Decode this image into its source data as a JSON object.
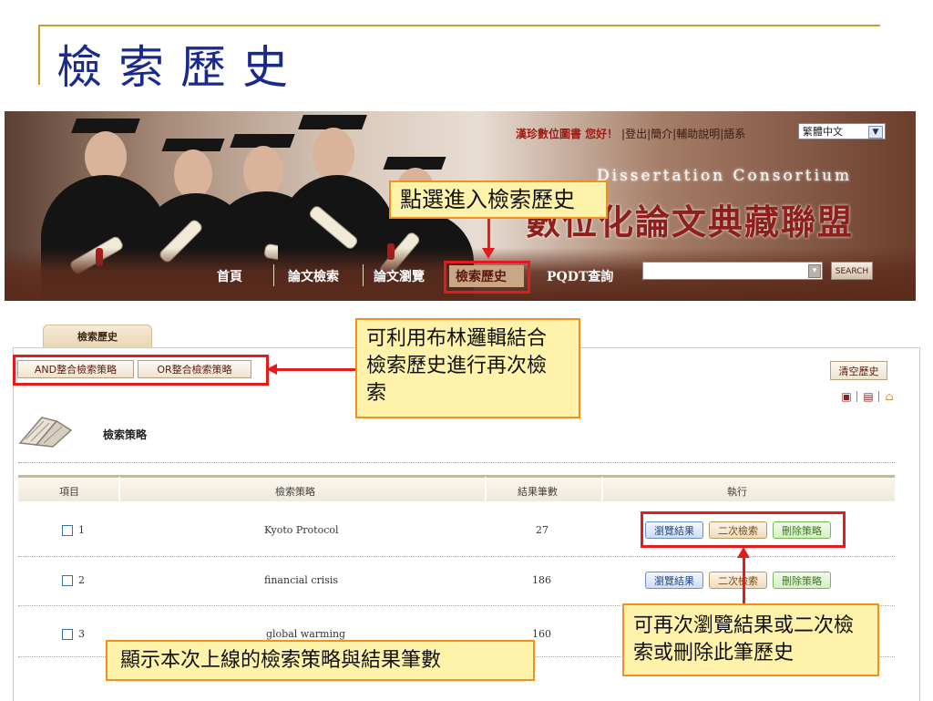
{
  "slide": {
    "title": "檢索歷史"
  },
  "header": {
    "user_greeting": "漢珍數位圖書 您好！",
    "links": [
      "登出",
      "簡介",
      "輔助說明",
      "語系"
    ],
    "language_selected": "繁體中文",
    "site_title_en": "Dissertation Consortium",
    "site_title_zh": "數位化論文典藏聯盟",
    "nav": [
      "首頁",
      "論文檢索",
      "論文瀏覽",
      "檢索歷史",
      "PQDT查詢"
    ],
    "search_button": "SEARCH",
    "search_value": ""
  },
  "panel": {
    "tab": "檢索歷史",
    "and_button": "AND整合檢索策略",
    "or_button": "OR整合檢索策略",
    "clear_button": "清空歷史",
    "section_label": "檢索策略",
    "columns": [
      "項目",
      "檢索策略",
      "結果筆數",
      "執行"
    ],
    "rows": [
      {
        "no": "1",
        "strategy": "Kyoto Protocol",
        "count": "27"
      },
      {
        "no": "2",
        "strategy": "financial crisis",
        "count": "186"
      },
      {
        "no": "3",
        "strategy": "global warming",
        "count": "160"
      }
    ],
    "actions": {
      "view": "瀏覽結果",
      "refine": "二次檢索",
      "delete": "刪除策略"
    }
  },
  "callouts": {
    "nav": "點選進入檢索歷史",
    "boolean": "可利用布林邏輯結合檢索歷史進行再次檢索",
    "actions": "可再次瀏覽結果或二次檢索或刪除此筆歷史",
    "summary": "顯示本次上線的檢索策略與結果筆數"
  },
  "colors": {
    "title": "#1a2a8c",
    "rule": "#c9a227",
    "highlight": "#e21c1c",
    "callout_bg": "#fff2aa",
    "callout_border": "#f0901e"
  }
}
